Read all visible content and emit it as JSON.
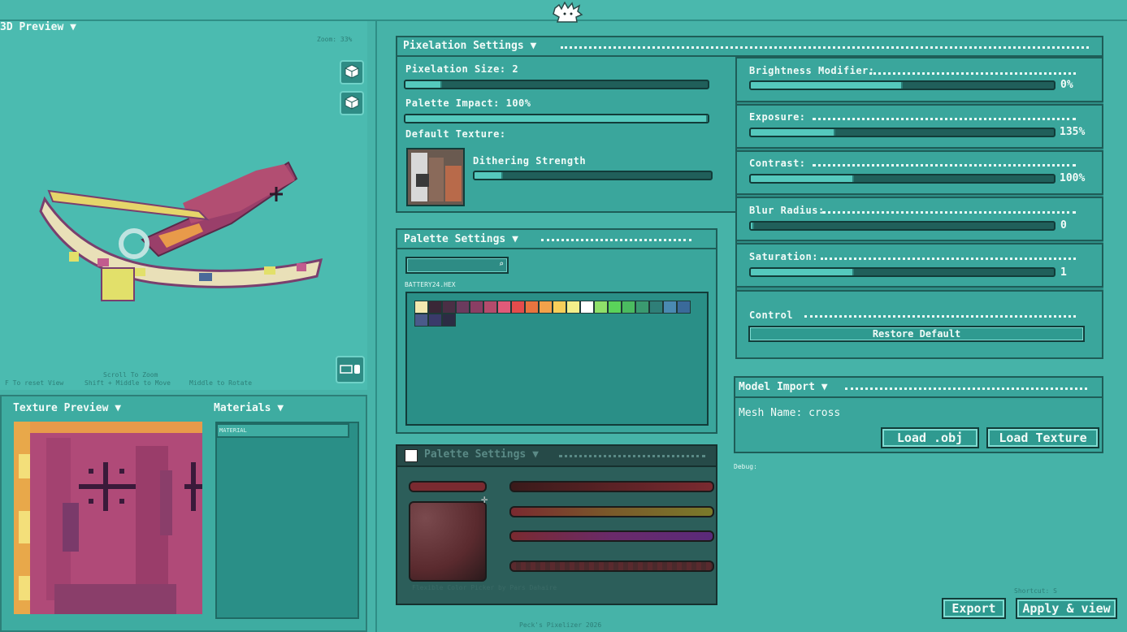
{
  "header": {
    "logo": "cat-logo-icon"
  },
  "preview3d": {
    "title": "3D Preview",
    "zoom": "Zoom: 33%",
    "hints": {
      "scroll": "Scroll To Zoom",
      "reset": "F To reset View",
      "move": "Shift + Middle to Move",
      "rotate": "Middle to Rotate"
    }
  },
  "texture_preview": {
    "title": "Texture Preview"
  },
  "materials": {
    "title": "Materials",
    "items": [
      "MATERIAL"
    ]
  },
  "pixelation": {
    "title": "Pixelation Settings",
    "size_label": "Pixelation Size: 2",
    "size_fill": 0.12,
    "impact_label": "Palette Impact: 100%",
    "impact_fill": 1.0,
    "default_texture_label": "Default Texture:",
    "dither_label": "Dithering Strength",
    "dither_fill": 0.12
  },
  "adjustments": [
    {
      "label": "Brightness Modifier:",
      "value": "0%",
      "fill": 0.5
    },
    {
      "label": "Exposure:",
      "value": "135%",
      "fill": 0.28
    },
    {
      "label": "Contrast:",
      "value": "100%",
      "fill": 0.34
    },
    {
      "label": "Blur Radius:",
      "value": "0",
      "fill": 0.0
    },
    {
      "label": "Saturation:",
      "value": "1",
      "fill": 0.34
    }
  ],
  "control": {
    "label": "Control",
    "restore": "Restore Default"
  },
  "palette": {
    "title": "Palette Settings",
    "search_placeholder": "",
    "file": "BATTERY24.HEX",
    "colors": [
      "#f3e9b0",
      "#3a2737",
      "#4a2f45",
      "#6b3b5e",
      "#8a3e64",
      "#b44b6c",
      "#e05a79",
      "#e44c4c",
      "#e8743f",
      "#f2a24a",
      "#f7cf5a",
      "#f3ef8a",
      "#ffffff",
      "#8fe06a",
      "#5ad35a",
      "#4bbb60",
      "#3a9a70",
      "#2f7f78",
      "#4a8ab2",
      "#3a6a9a",
      "#4a5a8a",
      "#3a3a6a",
      "#2c2c44"
    ]
  },
  "palette2": {
    "title": "Palette Settings",
    "credit": "Flexible Color Picker by Pars Dahaire"
  },
  "model_import": {
    "title": "Model Import",
    "mesh_name": "Mesh Name: cross",
    "load_obj": "Load .obj",
    "load_texture": "Load Texture"
  },
  "debug": "Debug:",
  "shortcut": "Shortcut: S",
  "export": "Export",
  "apply": "Apply & view",
  "footer": "Peck's Pixelizer 2026"
}
